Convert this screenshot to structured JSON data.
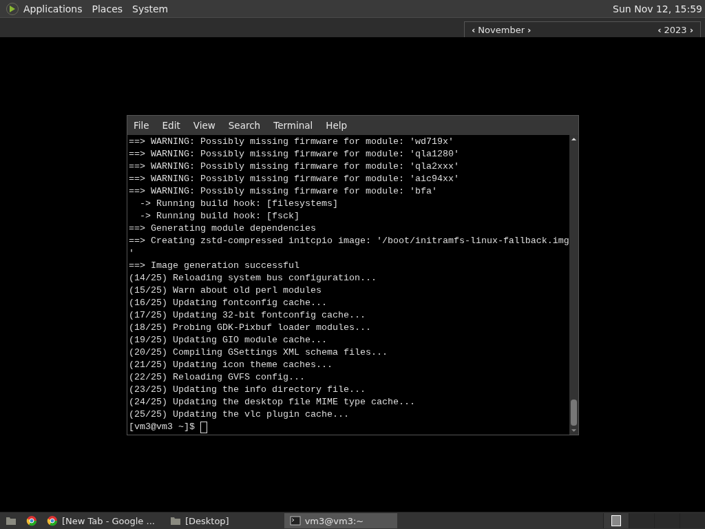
{
  "top_panel": {
    "menus": [
      "Applications",
      "Places",
      "System"
    ],
    "clock": "Sun Nov 12, 15:59"
  },
  "calendar": {
    "month": "November",
    "year": "2023",
    "prev": "‹",
    "next": "›"
  },
  "terminal": {
    "menu": [
      "File",
      "Edit",
      "View",
      "Search",
      "Terminal",
      "Help"
    ],
    "lines": [
      "==> WARNING: Possibly missing firmware for module: 'wd719x'",
      "==> WARNING: Possibly missing firmware for module: 'qla1280'",
      "==> WARNING: Possibly missing firmware for module: 'qla2xxx'",
      "==> WARNING: Possibly missing firmware for module: 'aic94xx'",
      "==> WARNING: Possibly missing firmware for module: 'bfa'",
      "  -> Running build hook: [filesystems]",
      "  -> Running build hook: [fsck]",
      "==> Generating module dependencies",
      "==> Creating zstd-compressed initcpio image: '/boot/initramfs-linux-fallback.img",
      "'",
      "==> Image generation successful",
      "(14/25) Reloading system bus configuration...",
      "(15/25) Warn about old perl modules",
      "(16/25) Updating fontconfig cache...",
      "(17/25) Updating 32-bit fontconfig cache...",
      "(18/25) Probing GDK-Pixbuf loader modules...",
      "(19/25) Updating GIO module cache...",
      "(20/25) Compiling GSettings XML schema files...",
      "(21/25) Updating icon theme caches...",
      "(22/25) Reloading GVFS config...",
      "(23/25) Updating the info directory file...",
      "(24/25) Updating the desktop file MIME type cache...",
      "(25/25) Updating the vlc plugin cache..."
    ],
    "prompt": "[vm3@vm3 ~]$"
  },
  "taskbar": {
    "tasks": [
      {
        "kind": "browser",
        "label": "[New Tab - Google ...",
        "selected": false
      },
      {
        "kind": "folder",
        "label": "[Desktop]",
        "selected": false
      },
      {
        "kind": "terminal",
        "label": "vm3@vm3:~",
        "selected": true
      }
    ],
    "workspaces": [
      {
        "selected": true
      },
      {
        "selected": false
      },
      {
        "selected": false
      },
      {
        "selected": false
      }
    ]
  }
}
